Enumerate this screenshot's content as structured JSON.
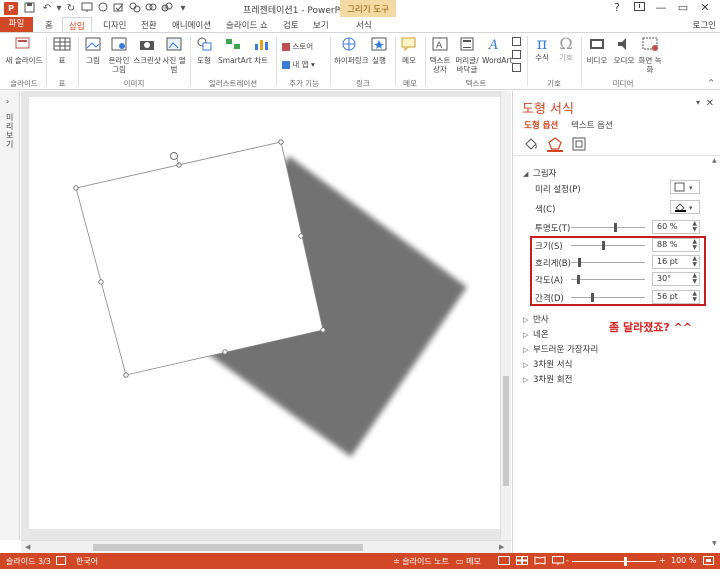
{
  "title_bar": {
    "app_badge": "P",
    "window_title": "프레젠테이션1 - PowerPoint",
    "context_tools": "그리기 도구",
    "help": "?",
    "minimize": "—",
    "restore": "▭",
    "close": "✕"
  },
  "tabs": {
    "file": "파일",
    "items": [
      "홈",
      "삽입",
      "디자인",
      "전환",
      "애니메이션",
      "슬라이드 쇼",
      "검토",
      "보기",
      "서식"
    ],
    "active": "삽입",
    "login": "로그인"
  },
  "ribbon": {
    "buttons": {
      "new_slide": "새 슬라이드",
      "table": "표",
      "picture": "그림",
      "online_picture": "온라인 그림",
      "screenshot": "스크린샷",
      "photo_album": "사진 앨범",
      "shapes": "도형",
      "smartart": "SmartArt",
      "chart": "차트",
      "store": "스토어",
      "my_apps": "내 앱",
      "hyperlink": "하이퍼링크",
      "action": "실행",
      "comment": "메모",
      "textbox": "텍스트 상자",
      "header_footer": "머리글/바닥글",
      "wordart": "WordArt",
      "equation": "수식",
      "symbol": "기호",
      "video": "비디오",
      "audio": "오디오",
      "screen_recording": "화면 녹화"
    },
    "groups": {
      "slides": "슬라이드",
      "tables": "표",
      "images": "이미지",
      "illustrations": "일러스트레이션",
      "addins": "추가 기능",
      "links": "링크",
      "comments": "메모",
      "text": "텍스트",
      "symbols": "기호",
      "media": "미디어"
    }
  },
  "left_panel": {
    "label": "미리보기"
  },
  "format_pane": {
    "title": "도형 서식",
    "tab_shape": "도형 옵션",
    "tab_text": "텍스트 옵션",
    "shadow_section": "그림자",
    "props": {
      "preset": "미리 설정(P)",
      "color": "색(C)",
      "transparency": "투명도(T)",
      "transparency_value": "60 %",
      "transparency_level": 0.6,
      "size": "크기(S)",
      "size_value": "88 %",
      "size_level": 0.44,
      "blur": "흐리게(B)",
      "blur_value": "16 pt",
      "blur_level": 0.1,
      "angle": "각도(A)",
      "angle_value": "30°",
      "angle_level": 0.08,
      "distance": "간격(D)",
      "distance_value": "56 pt",
      "distance_level": 0.28
    },
    "sections": [
      "반사",
      "네온",
      "부드러운 가장자리",
      "3차원 서식",
      "3차원 회전"
    ],
    "annotation": "좀 달라졌죠? ^^",
    "accent": "#d24726",
    "highlight_color": "#c41e1e"
  },
  "status_bar": {
    "slide_info": "슬라이드 3/3",
    "language": "한국어",
    "notes": "슬라이드 노트",
    "comments": "메모",
    "zoom_minus": "-",
    "zoom_plus": "+",
    "zoom": "100 %"
  }
}
